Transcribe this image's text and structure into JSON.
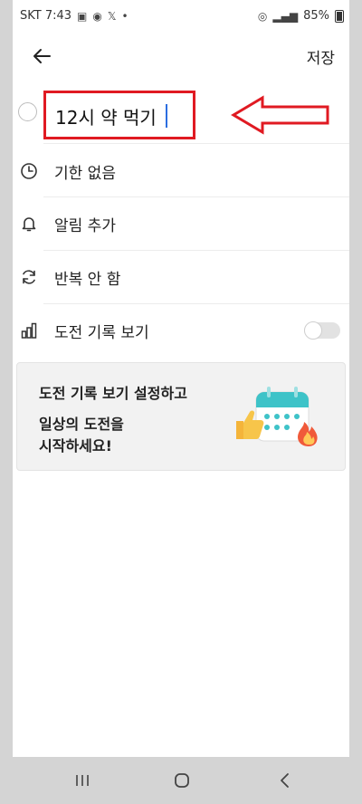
{
  "status_bar": {
    "carrier_time": "SKT 7:43",
    "battery": "85%",
    "icons": [
      "gallery-icon",
      "location-icon",
      "x-icon",
      "dot-icon",
      "hotspot-icon",
      "signal-icon",
      "battery-icon"
    ]
  },
  "header": {
    "back_icon": "arrow-left-icon",
    "save_label": "저장"
  },
  "task": {
    "title_value": "12시 약 먹기"
  },
  "options": [
    {
      "icon": "clock-icon",
      "label": "기한 없음"
    },
    {
      "icon": "bell-icon",
      "label": "알림 추가"
    },
    {
      "icon": "repeat-icon",
      "label": "반복 안 함"
    },
    {
      "icon": "bar-chart-icon",
      "label": "도전 기록 보기",
      "toggle_on": false
    }
  ],
  "promo": {
    "line1": "도전 기록 보기 설정하고",
    "line2a": "일상의 도전을",
    "line2b": "시작하세요!",
    "illustration": "calendar-thumbsup-fire-icon"
  },
  "colors": {
    "annotation_red": "#e01a22",
    "caret_blue": "#2b6de0",
    "calendar_teal": "#3ec3c8"
  }
}
